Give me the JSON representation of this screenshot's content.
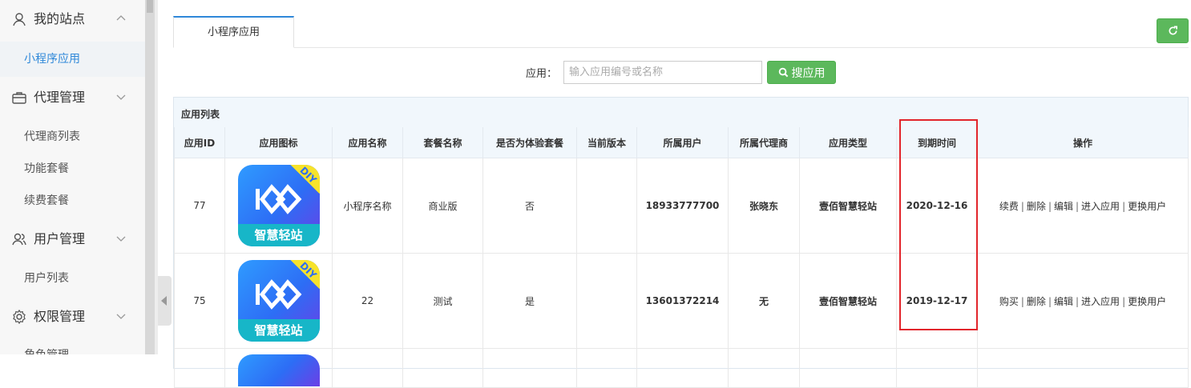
{
  "sidebar": {
    "groups": [
      {
        "label": "我的站点",
        "icon": "user-icon"
      },
      {
        "label": "代理管理",
        "icon": "briefcase-icon"
      },
      {
        "label": "用户管理",
        "icon": "users-icon"
      },
      {
        "label": "权限管理",
        "icon": "gear-icon"
      }
    ],
    "items": {
      "app": "小程序应用",
      "agent_list": "代理商列表",
      "packages": "功能套餐",
      "renew_packages": "续费套餐",
      "user_list": "用户列表",
      "role_mgmt": "角色管理"
    }
  },
  "tabs": [
    {
      "label": "小程序应用",
      "active": true
    }
  ],
  "search": {
    "label": "应用：",
    "placeholder": "输入应用编号或名称",
    "value": "",
    "button": "搜应用"
  },
  "panel_title": "应用列表",
  "table": {
    "headers": [
      "应用ID",
      "应用图标",
      "应用名称",
      "套餐名称",
      "是否为体验套餐",
      "当前版本",
      "所属用户",
      "所属代理商",
      "应用类型",
      "到期时间",
      "操作"
    ],
    "rows": [
      {
        "id": "77",
        "icon_text": "智慧轻站",
        "icon_badge": "DIY",
        "name": "小程序名称",
        "package": "商业版",
        "trial": "否",
        "version": "",
        "user": "18933777700",
        "agent": "张晓东",
        "type": "壹佰智慧轻站",
        "expire": "2020-12-16",
        "ops": [
          "续费",
          "删除",
          "编辑",
          "进入应用",
          "更换用户"
        ]
      },
      {
        "id": "75",
        "icon_text": "智慧轻站",
        "icon_badge": "DIY",
        "name": "22",
        "package": "测试",
        "trial": "是",
        "version": "",
        "user": "13601372214",
        "agent": "无",
        "type": "壹佰智慧轻站",
        "expire": "2019-12-17",
        "ops": [
          "购买",
          "删除",
          "编辑",
          "进入应用",
          "更换用户"
        ]
      }
    ]
  },
  "colors": {
    "accent": "#2f88d9",
    "green": "#5cb85c",
    "highlight": "#e2252b"
  }
}
